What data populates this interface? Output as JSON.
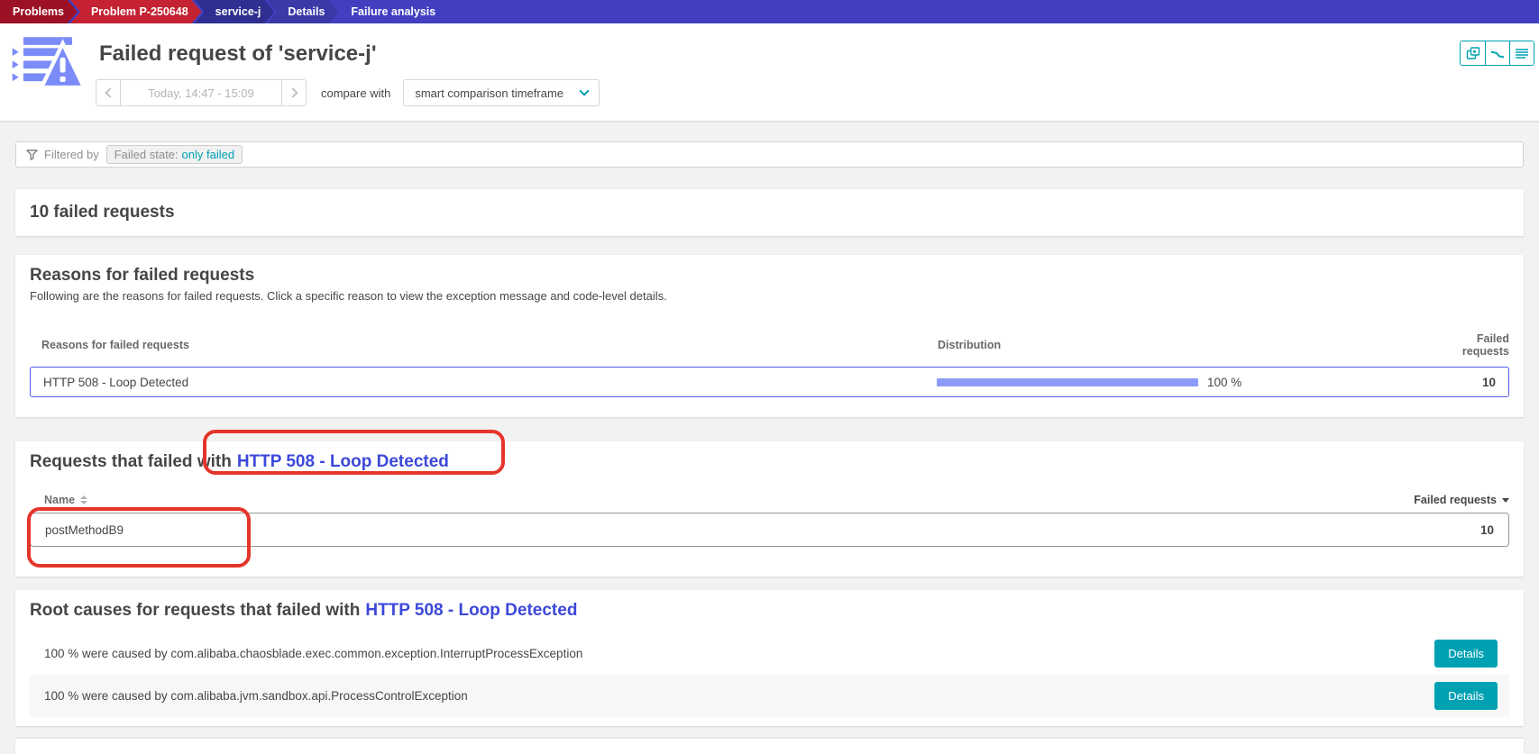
{
  "breadcrumb": {
    "items": [
      {
        "label": "Problems"
      },
      {
        "label": "Problem P-250648"
      },
      {
        "label": "service-j"
      },
      {
        "label": "Details"
      },
      {
        "label": "Failure analysis"
      }
    ]
  },
  "header": {
    "title": "Failed request of 'service-j'",
    "timeframe": "Today, 14:47 - 15:09",
    "compare_label": "compare with",
    "comparison_dropdown": "smart comparison timeframe",
    "view_icons": [
      "export-pages-icon",
      "trend-line-icon",
      "list-view-icon"
    ]
  },
  "filter": {
    "label": "Filtered by",
    "chip_key": "Failed state:",
    "chip_value": "only failed"
  },
  "summary": {
    "title": "10 failed requests"
  },
  "reasons": {
    "title": "Reasons for failed requests",
    "subtitle": "Following are the reasons for failed requests. Click a specific reason to view the exception message and code-level details.",
    "columns": [
      "Reasons for failed requests",
      "Distribution",
      "Failed requests"
    ],
    "rows": [
      {
        "reason": "HTTP 508 - Loop Detected",
        "distribution_value": 100,
        "distribution_pct": "100 %",
        "failed_requests": "10"
      }
    ]
  },
  "requests": {
    "title_prefix": "Requests that failed with",
    "title_reason": "HTTP 508 - Loop Detected",
    "columns": {
      "name": "Name",
      "failed": "Failed requests"
    },
    "rows": [
      {
        "name": "postMethodB9",
        "failed_requests": "10"
      }
    ]
  },
  "root_causes": {
    "title_prefix": "Root causes for requests that failed with",
    "title_reason": "HTTP 508 - Loop Detected",
    "rows": [
      {
        "text": "100 % were caused by com.alibaba.chaosblade.exec.common.exception.InterruptProcessException",
        "button": "Details"
      },
      {
        "text": "100 % were caused by com.alibaba.jvm.sandbox.api.ProcessControlException",
        "button": "Details"
      }
    ]
  },
  "colors": {
    "accent_teal": "#00a1b2",
    "heading_link_blue": "#3c48d9",
    "distribution_bar": "#8d9bf8",
    "selected_row_border": "#4f5ff0",
    "annotation_red": "#e5352b",
    "breadcrumb_bar": "#413fc0",
    "crumb_problems": "#9c1126",
    "crumb_problem_id": "#c52233",
    "crumb_service": "#2e2f91",
    "crumb_details": "#3939a8",
    "app_icon_indigo": "#7b8cf8",
    "page_bg": "#f2f2f2"
  }
}
